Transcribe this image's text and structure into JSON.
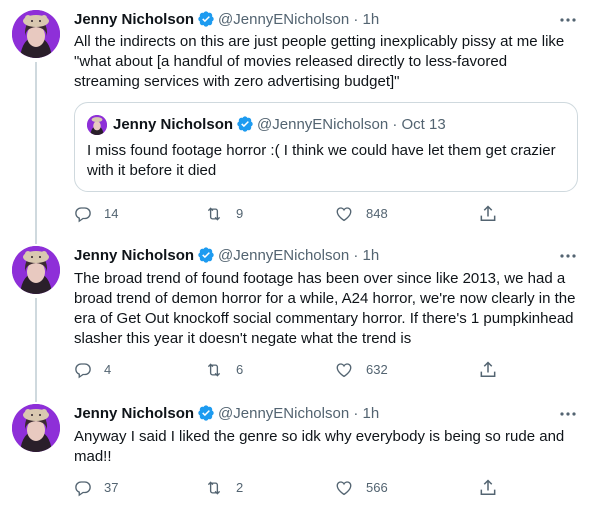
{
  "tweets": [
    {
      "name": "Jenny Nicholson",
      "handle": "@JennyENicholson",
      "dot": "·",
      "time": "1h",
      "text": "All the indirects on this are just people getting inexplicably pissy at me like\n\"what about [a handful of movies released directly to less-favored\nstreaming services with zero advertising budget]\"",
      "quote": {
        "name": "Jenny Nicholson",
        "handle": "@JennyENicholson",
        "dot": "·",
        "time": "Oct 13",
        "text": "I miss found footage horror :( I think we could have let them get crazier\nwith it before it died"
      },
      "replies": "14",
      "retweets": "9",
      "likes": "848"
    },
    {
      "name": "Jenny Nicholson",
      "handle": "@JennyENicholson",
      "dot": "·",
      "time": "1h",
      "text": "The broad trend of found footage has been over since like 2013, we had a\nbroad trend of demon horror for a while, A24 horror, we're now clearly in the\nera of Get Out knockoff social commentary horror. If there's 1 pumpkinhead\nslasher this year it doesn't negate what the trend is",
      "replies": "4",
      "retweets": "6",
      "likes": "632"
    },
    {
      "name": "Jenny Nicholson",
      "handle": "@JennyENicholson",
      "dot": "·",
      "time": "1h",
      "text": "Anyway I said I liked the genre so idk why everybody is being so rude and\nmad!!",
      "replies": "37",
      "retweets": "2",
      "likes": "566"
    }
  ],
  "icons": {
    "verified": "verified-badge-icon",
    "more": "more-dots-icon",
    "reply": "reply-icon",
    "retweet": "retweet-icon",
    "like": "heart-icon",
    "share": "share-icon"
  },
  "colors": {
    "text": "#0f1419",
    "secondary": "#536471",
    "verified": "#1d9bf0",
    "border": "#cfd9de"
  }
}
